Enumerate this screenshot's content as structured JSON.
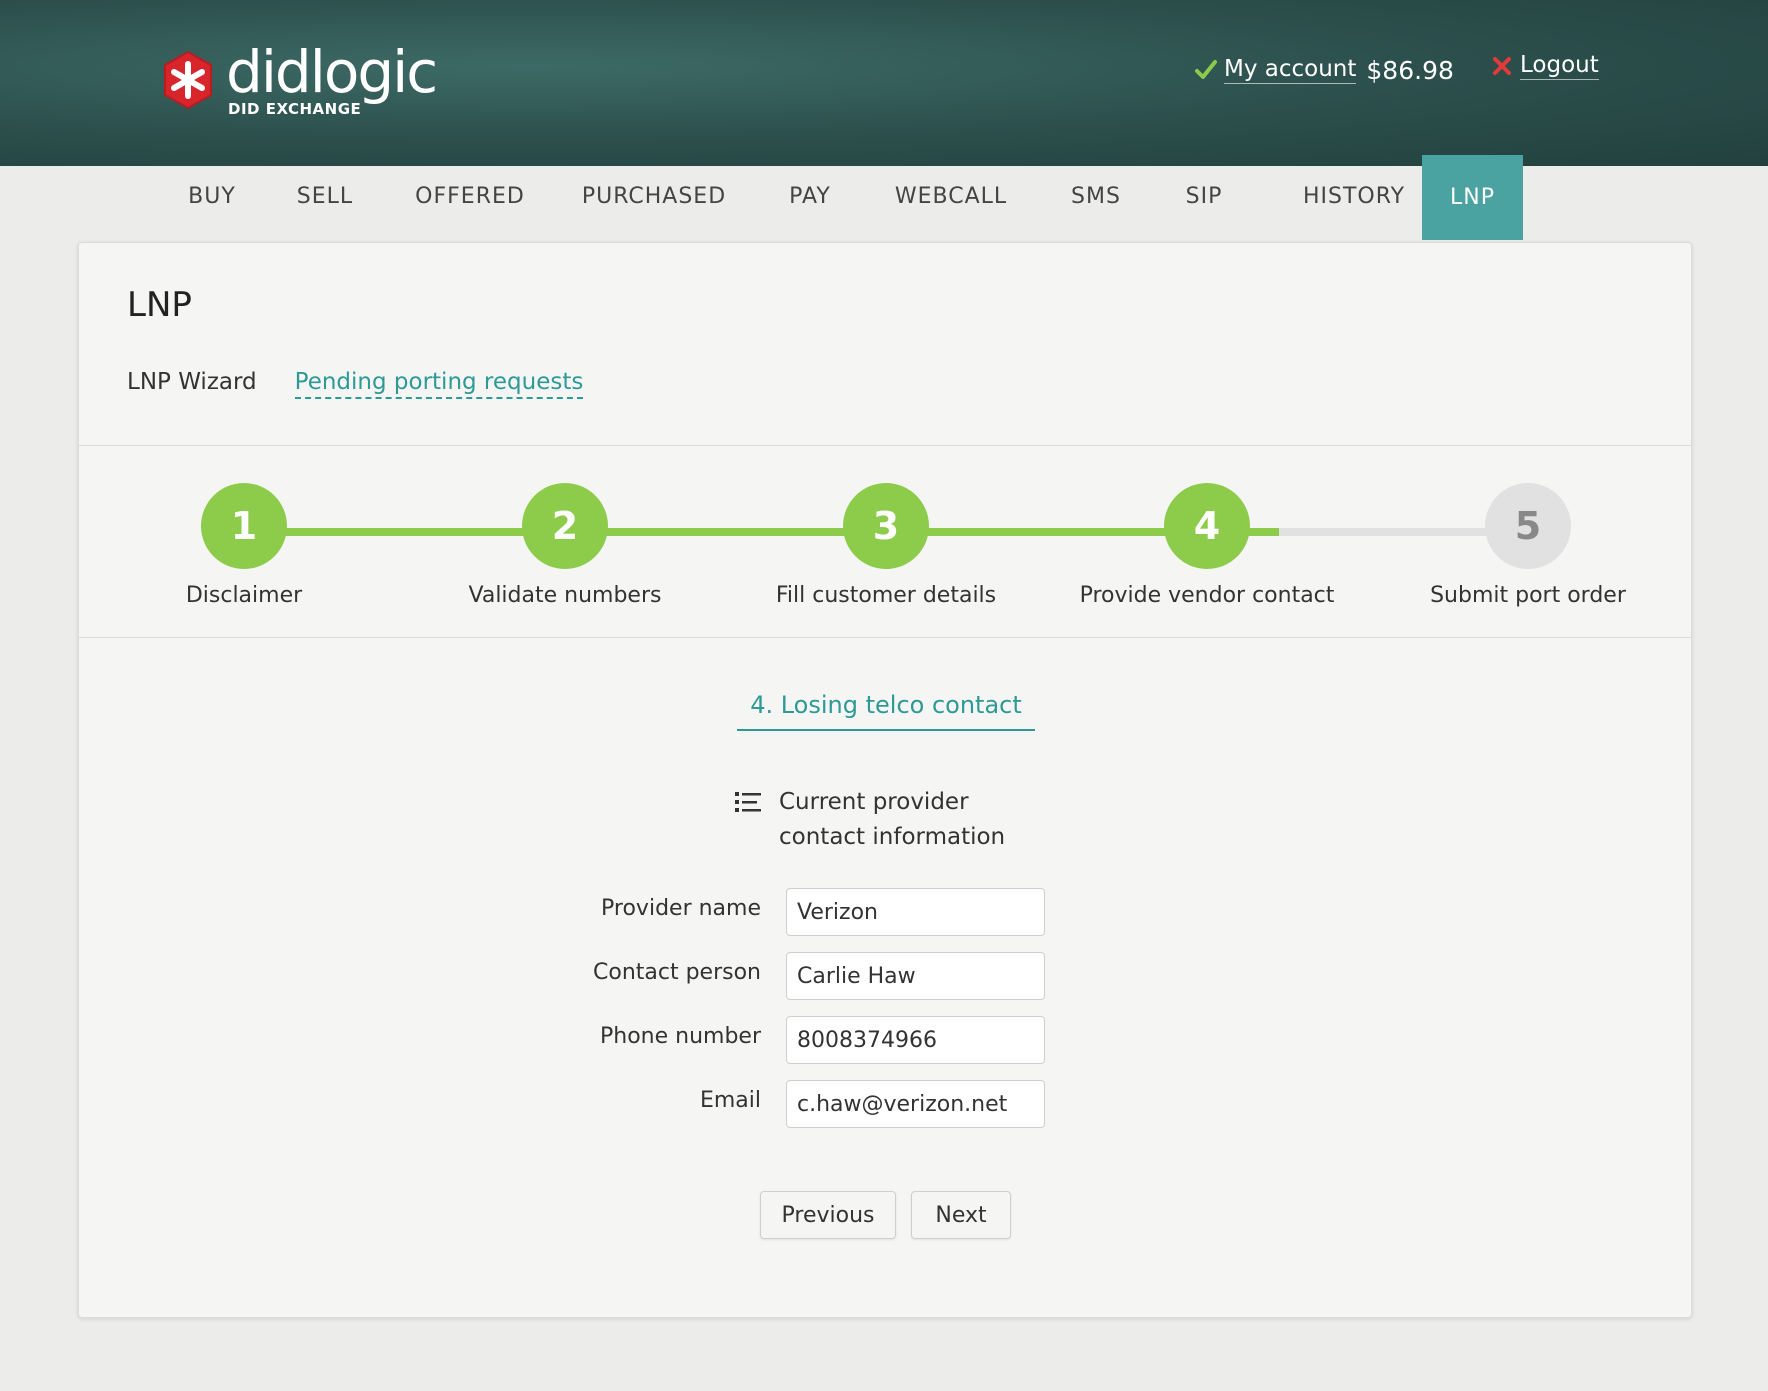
{
  "brand": {
    "name": "didlogic",
    "tagline": "DID EXCHANGE",
    "logo_icon": "asterisk-icon",
    "accent_color": "#d8252b"
  },
  "header": {
    "account_link": "My account",
    "balance": "$86.98",
    "logout_link": "Logout",
    "check_icon": "check-icon",
    "close_icon": "close-icon"
  },
  "nav": {
    "items": [
      {
        "label": "BUY"
      },
      {
        "label": "SELL"
      },
      {
        "label": "OFFERED"
      },
      {
        "label": "PURCHASED"
      },
      {
        "label": "PAY"
      },
      {
        "label": "WEBCALL"
      },
      {
        "label": "SMS"
      },
      {
        "label": "SIP"
      },
      {
        "label": "HISTORY"
      },
      {
        "label": "LNP",
        "active": true
      }
    ],
    "active_color": "#4aa3a0"
  },
  "page": {
    "title": "LNP",
    "subnav": {
      "wizard": "LNP Wizard",
      "pending": "Pending porting requests"
    }
  },
  "wizard": {
    "completed_color": "#8ccc4a",
    "pending_color": "#e1e1e1",
    "current_step": 4,
    "steps": [
      {
        "number": "1",
        "label": "Disclaimer",
        "status": "done"
      },
      {
        "number": "2",
        "label": "Validate numbers",
        "status": "done"
      },
      {
        "number": "3",
        "label": "Fill customer details",
        "status": "done"
      },
      {
        "number": "4",
        "label": "Provide vendor contact",
        "status": "current"
      },
      {
        "number": "5",
        "label": "Submit port order",
        "status": "todo"
      }
    ]
  },
  "form": {
    "section_title": "4. Losing telco contact",
    "info_heading": "Current provider contact information",
    "info_icon": "list-icon",
    "fields": {
      "provider_name": {
        "label": "Provider name",
        "value": "Verizon"
      },
      "contact_person": {
        "label": "Contact person",
        "value": "Carlie Haw"
      },
      "phone_number": {
        "label": "Phone number",
        "value": "8008374966"
      },
      "email": {
        "label": "Email",
        "value": "c.haw@verizon.net"
      }
    },
    "previous_label": "Previous",
    "next_label": "Next"
  }
}
